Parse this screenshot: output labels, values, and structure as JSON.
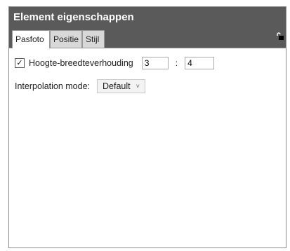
{
  "panel": {
    "title": "Element eigenschappen",
    "tabs": [
      {
        "label": "Pasfoto",
        "active": true
      },
      {
        "label": "Positie",
        "active": false
      },
      {
        "label": "Stijl",
        "active": false
      }
    ],
    "lock_icon": "lock-open-icon"
  },
  "pasfoto": {
    "aspect_ratio": {
      "label": "Hoogte-breedteverhouding",
      "checked": true,
      "width_value": "3",
      "separator": ":",
      "height_value": "4"
    },
    "interpolation": {
      "label": "Interpolation mode:",
      "selected": "Default",
      "chevron": "˅"
    }
  },
  "colors": {
    "titlebar": "#5a5a5a",
    "title_text": "#ffffff"
  }
}
